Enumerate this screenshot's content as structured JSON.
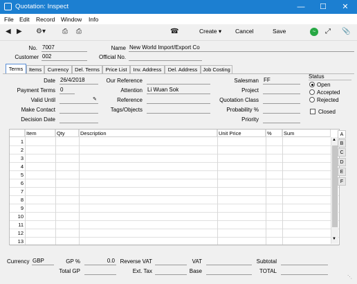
{
  "window": {
    "title": "Quotation: Inspect"
  },
  "menu": [
    "File",
    "Edit",
    "Record",
    "Window",
    "Info"
  ],
  "toolbar": {
    "create": "Create",
    "cancel": "Cancel",
    "save": "Save"
  },
  "header": {
    "no_label": "No.",
    "no_value": "7007",
    "customer_label": "Customer",
    "customer_value": "002",
    "name_label": "Name",
    "name_value": "New World Import/Export Co",
    "official_no_label": "Official No.",
    "official_no_value": ""
  },
  "tabs": [
    "Terms",
    "Items",
    "Currency",
    "Del. Terms",
    "Price List",
    "Inv. Address",
    "Del. Address",
    "Job Costing"
  ],
  "terms": {
    "date_label": "Date",
    "date_value": "26/4/2018",
    "payment_terms_label": "Payment Terms",
    "payment_terms_value": "0",
    "valid_until_label": "Valid Until",
    "valid_until_value": "",
    "make_contact_label": "Make Contact",
    "make_contact_value": "",
    "decision_date_label": "Decision Date",
    "decision_date_value": "",
    "our_reference_label": "Our Reference",
    "our_reference_value": "",
    "attention_label": "Attention",
    "attention_value": "Li Wuan Sok",
    "reference_label": "Reference",
    "reference_value": "",
    "tags_label": "Tags/Objects",
    "tags_value": "",
    "salesman_label": "Salesman",
    "salesman_value": "FF",
    "project_label": "Project",
    "project_value": "",
    "quotation_class_label": "Quotation Class",
    "quotation_class_value": "",
    "probability_label": "Probability %",
    "probability_value": "",
    "priority_label": "Priority",
    "priority_value": ""
  },
  "status": {
    "title": "Status",
    "options": [
      "Open",
      "Accepted",
      "Rejected"
    ],
    "selected": "Open",
    "closed_label": "Closed"
  },
  "grid": {
    "columns": [
      "Item",
      "Qty",
      "Description",
      "Unit Price",
      "%",
      "Sum"
    ],
    "rows": [
      "1",
      "2",
      "3",
      "4",
      "5",
      "6",
      "7",
      "8",
      "9",
      "10",
      "11",
      "12",
      "13"
    ],
    "side_tabs": [
      "A",
      "B",
      "C",
      "D",
      "E",
      "F"
    ]
  },
  "footer": {
    "currency_label": "Currency",
    "currency_value": "GBP",
    "gp_label": "GP %",
    "gp_value": "0.0",
    "total_gp_label": "Total GP",
    "total_gp_value": "",
    "reverse_vat_label": "Reverse VAT",
    "reverse_vat_value": "",
    "ext_tax_label": "Ext. Tax",
    "ext_tax_value": "",
    "vat_label": "VAT",
    "vat_value": "",
    "base_label": "Base",
    "base_value": "",
    "subtotal_label": "Subtotal",
    "subtotal_value": "",
    "total_label": "TOTAL",
    "total_value": ""
  }
}
